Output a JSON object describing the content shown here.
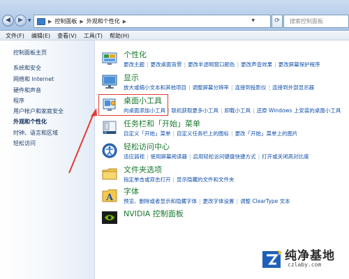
{
  "address_bar": {
    "crumbs": [
      "控制面板",
      "外观和个性化"
    ],
    "search_placeholder": "搜索控制面板"
  },
  "menu": [
    "文件(F)",
    "编辑(E)",
    "查看(V)",
    "工具(T)",
    "帮助(H)"
  ],
  "left_pane": {
    "items": [
      {
        "label": "控制面板主页",
        "active": false
      },
      {
        "label": "系统和安全",
        "active": false
      },
      {
        "label": "网络和 Internet",
        "active": false
      },
      {
        "label": "硬件和声音",
        "active": false
      },
      {
        "label": "程序",
        "active": false
      },
      {
        "label": "用户帐户和家庭安全",
        "active": false
      },
      {
        "label": "外观和个性化",
        "active": true
      },
      {
        "label": "时钟、语言和区域",
        "active": false
      },
      {
        "label": "轻松访问",
        "active": false
      }
    ]
  },
  "categories": [
    {
      "title": "个性化",
      "icon": "personalization-icon",
      "links": [
        "更改主题",
        "更改桌面背景",
        "更改半透明窗口颜色",
        "更改声音效果",
        "更改屏幕保护程序"
      ]
    },
    {
      "title": "显示",
      "icon": "display-icon",
      "links": [
        "放大或缩小文本和其他项目",
        "调整屏幕分辨率",
        "连接到投影仪",
        "连接到外部显示器"
      ]
    },
    {
      "title": "桌面小工具",
      "icon": "gadgets-icon",
      "links": [
        "向桌面添加小工具",
        "联机获取更多小工具",
        "卸载小工具",
        "还原 Windows 上安装的桌面小工具"
      ]
    },
    {
      "title": "任务栏和「开始」菜单",
      "icon": "taskbar-icon",
      "links": [
        "自定义「开始」菜单",
        "自定义任务栏上的图标",
        "更改「开始」菜单上的图片"
      ]
    },
    {
      "title": "轻松访问中心",
      "icon": "ease-of-access-icon",
      "links": [
        "适应弱视",
        "使用屏幕阅读器",
        "启用轻松访问键盘快捷方式",
        "打开或关闭高对比度"
      ]
    },
    {
      "title": "文件夹选项",
      "icon": "folder-options-icon",
      "links": [
        "指定单击或双击打开",
        "显示隐藏的文件和文件夹"
      ]
    },
    {
      "title": "字体",
      "icon": "fonts-icon",
      "links": [
        "预览、删除或者显示和隐藏字体",
        "更改字体设置",
        "调整 ClearType 文本"
      ]
    },
    {
      "title": "NVIDIA 控制面板",
      "icon": "nvidia-icon",
      "links": []
    }
  ],
  "watermark": {
    "title": "纯净基地",
    "subtitle": "czlaby.com"
  },
  "colors": {
    "accent_green": "#1a7a2e",
    "link_blue": "#0f4fa8",
    "highlight_red": "#e33b32"
  }
}
